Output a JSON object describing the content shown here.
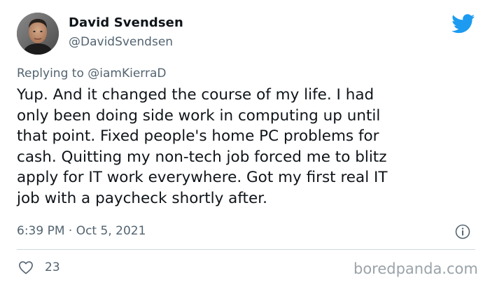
{
  "author": {
    "display_name": "David Svendsen",
    "handle": "@DavidSvendsen",
    "avatar_icon": "profile-photo"
  },
  "reply_to": {
    "label": "Replying to @iamKierraD"
  },
  "tweet": {
    "lines": [
      "Yup. And it changed the course of my life. I had",
      "only been doing side work in computing up until",
      "that point. Fixed people's home PC problems for",
      "cash. Quitting my non-tech job forced me to blitz",
      "apply for IT work everywhere. Got my first real IT",
      "job with a paycheck shortly after."
    ],
    "timestamp": "6:39 PM · Oct 5, 2021"
  },
  "actions": {
    "like_icon": "heart-icon",
    "like_count": "23",
    "info_icon": "info-icon"
  },
  "branding": {
    "platform_icon": "twitter-bird-icon",
    "watermark": "boredpanda.com"
  },
  "colors": {
    "text_primary": "#0f1419",
    "text_secondary": "#536471",
    "twitter_blue": "#1d9bf0",
    "divider": "#cfd9de",
    "watermark": "#9aa3a9"
  }
}
